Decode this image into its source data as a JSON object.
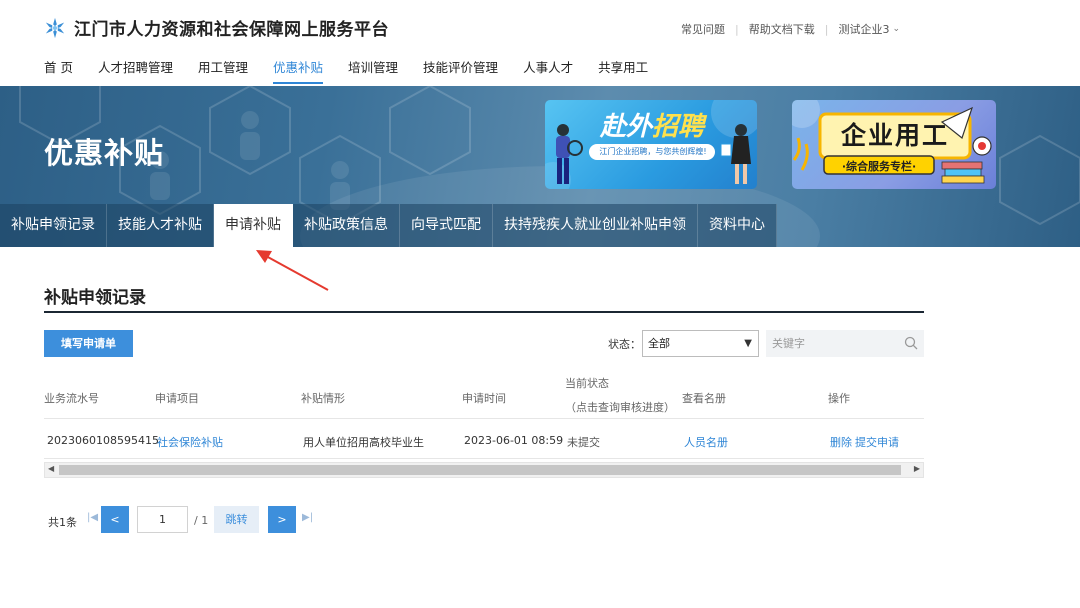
{
  "site": {
    "logo_text": "江门市人力资源和社会保障网上服务平台",
    "top_links": [
      "常见问题",
      "帮助文档下载"
    ],
    "user_label": "测试企业3"
  },
  "mainnav": {
    "items": [
      "首 页",
      "人才招聘管理",
      "用工管理",
      "优惠补贴",
      "培训管理",
      "技能评价管理",
      "人事人才",
      "共享用工"
    ],
    "active_index": 3
  },
  "banner": {
    "title": "优惠补贴",
    "promo1": {
      "title_part1": "赴外",
      "title_part2": "招聘",
      "subtitle": "江门企业招聘，与您共创辉煌!"
    },
    "promo2": {
      "title": "企业用工",
      "subtitle": "·综合服务专栏·"
    }
  },
  "subnav": {
    "tabs": [
      "补贴申领记录",
      "技能人才补贴",
      "申请补贴",
      "补贴政策信息",
      "向导式匹配",
      "扶持残疾人就业创业补贴申领",
      "资料中心"
    ],
    "active_index": 2
  },
  "section": {
    "title": "补贴申领记录",
    "fill_button": "填写申请单",
    "status_label": "状态：",
    "status_value": "全部",
    "keyword_placeholder": "关键字"
  },
  "table": {
    "headers": {
      "serial": "业务流水号",
      "item": "申请项目",
      "situation": "补贴情形",
      "time": "申请时间",
      "status_line1": "当前状态",
      "status_line2": "（点击查询审核进度）",
      "roster": "查看名册",
      "ops": "操作"
    },
    "rows": [
      {
        "serial": "2023060108595415",
        "item": "社会保险补贴",
        "situation": "用人单位招用高校毕业生",
        "time": "2023-06-01 08:59",
        "status": "未提交",
        "roster": "人员名册",
        "delete": "删除",
        "submit": "提交申请"
      }
    ]
  },
  "pager": {
    "total": "共1条",
    "prev": "<",
    "page": "1",
    "of_total": "/ 1",
    "jump": "跳转",
    "next": ">"
  },
  "colors": {
    "accent": "#3d8fdc",
    "link": "#2f86d6",
    "annotation_arrow": "#e53a2f"
  }
}
